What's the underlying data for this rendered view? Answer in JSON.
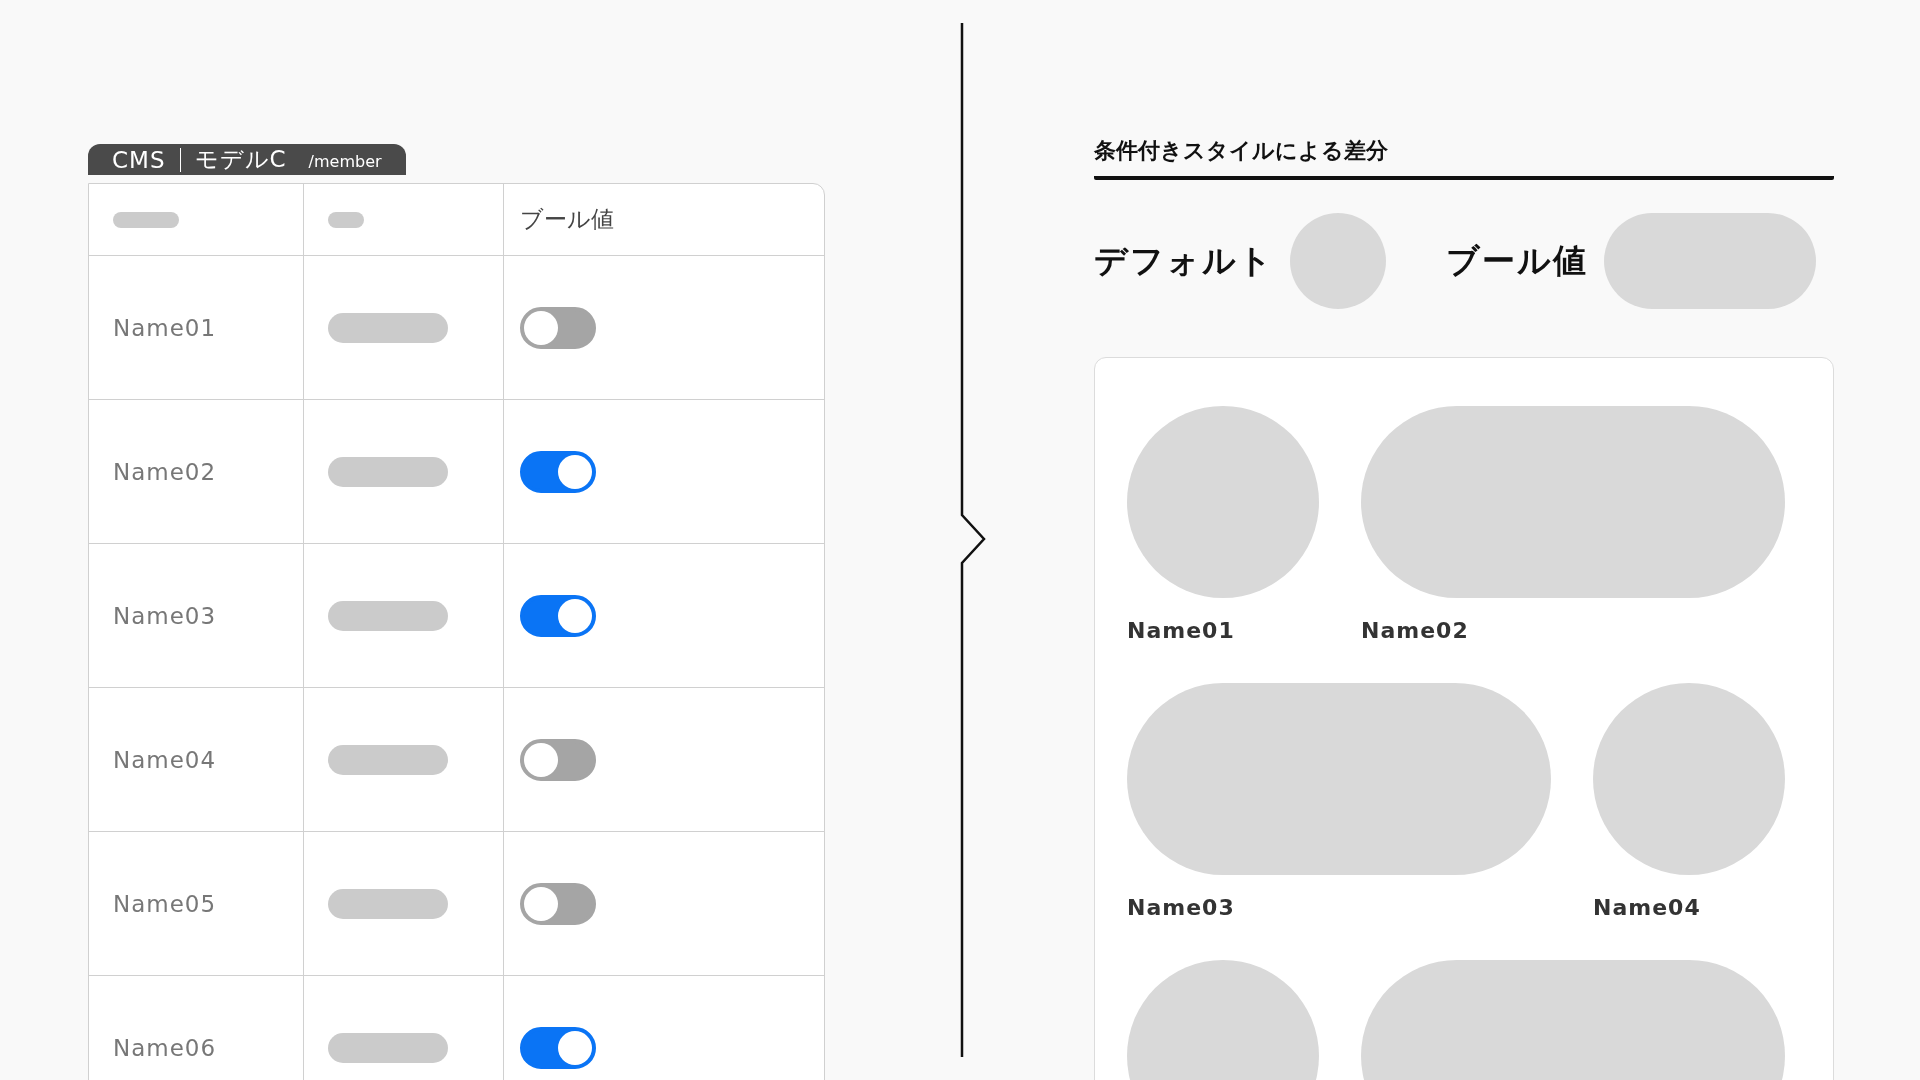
{
  "tab": {
    "app": "CMS",
    "model": "モデルC",
    "path": "/member"
  },
  "table": {
    "header": "ブール値",
    "rows": [
      {
        "name": "Name01",
        "on": false
      },
      {
        "name": "Name02",
        "on": true
      },
      {
        "name": "Name03",
        "on": true
      },
      {
        "name": "Name04",
        "on": false
      },
      {
        "name": "Name05",
        "on": false
      },
      {
        "name": "Name06",
        "on": true
      }
    ]
  },
  "panel": {
    "title": "条件付きスタイルによる差分",
    "legend": [
      {
        "label": "デフォルト",
        "kind": "circle"
      },
      {
        "label": "ブール値",
        "kind": "pill"
      }
    ],
    "rows": [
      [
        {
          "name": "Name01",
          "kind": "circle"
        },
        {
          "name": "Name02",
          "kind": "pill"
        }
      ],
      [
        {
          "name": "Name03",
          "kind": "pill"
        },
        {
          "name": "Name04",
          "kind": "circle"
        }
      ],
      [
        {
          "kind": "circle"
        },
        {
          "kind": "pill"
        }
      ]
    ]
  }
}
